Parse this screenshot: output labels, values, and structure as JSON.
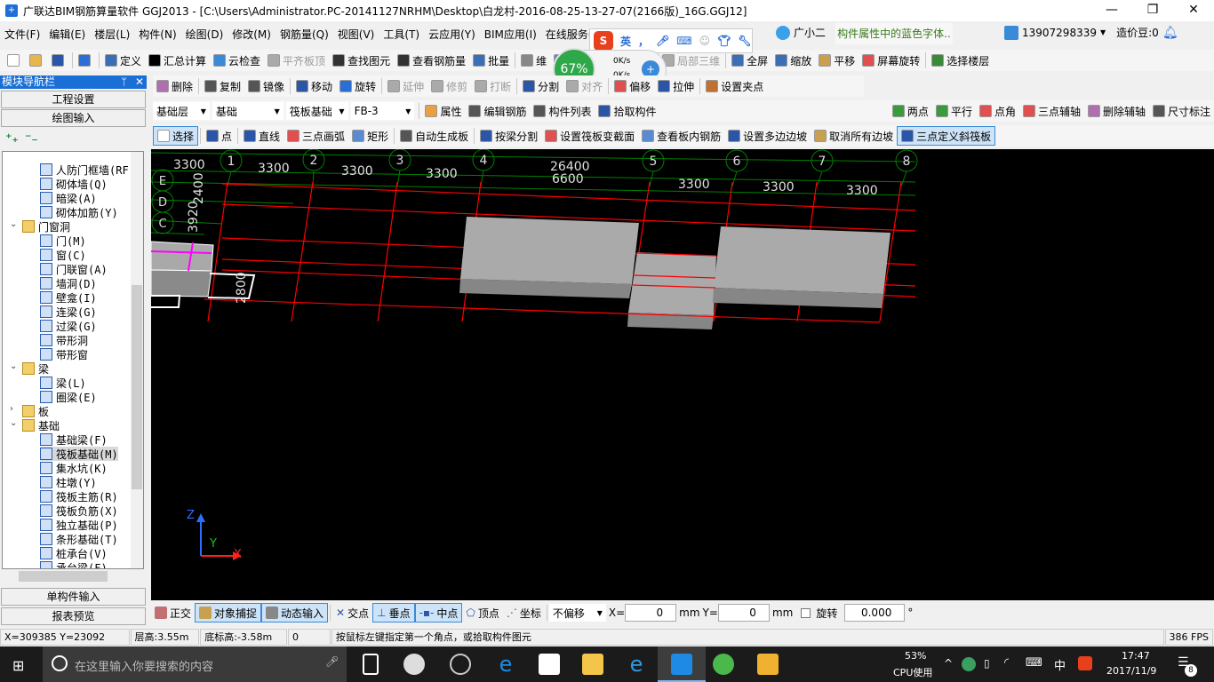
{
  "window": {
    "title": "广联达BIM钢筋算量软件 GGJ2013 - [C:\\Users\\Administrator.PC-20141127NRHM\\Desktop\\白龙村-2016-08-25-13-27-07(2166版)_16G.GGJ12]",
    "minimize": "—",
    "maximize": "❐",
    "close": "✕"
  },
  "menu": [
    "文件(F)",
    "编辑(E)",
    "楼层(L)",
    "构件(N)",
    "绘图(D)",
    "修改(M)",
    "钢筋量(Q)",
    "视图(V)",
    "工具(T)",
    "云应用(Y)",
    "BIM应用(I)",
    "在线服务(S)"
  ],
  "menu_right": {
    "assistant": "广小二",
    "tip": "构件属性中的蓝色字体..",
    "account": "13907298339",
    "beans": "造价豆:0"
  },
  "ime_bar": {
    "lang": "英",
    "punct": "，"
  },
  "net_widget": {
    "percent": "67%",
    "up": "0K/s",
    "down": "0K/s"
  },
  "toolbar1": [
    {
      "label": "",
      "icon": "new-file",
      "color": "#fff"
    },
    {
      "label": "",
      "icon": "open-folder",
      "color": "#e8b64a"
    },
    {
      "label": "",
      "icon": "save",
      "color": "#2b55a8"
    },
    {
      "label": "",
      "icon": "undo",
      "color": "#2b6fd6"
    },
    {
      "label": "定义",
      "icon": "define",
      "color": "#3a6fb8"
    },
    {
      "label": "汇总计算",
      "icon": "sigma",
      "color": "#000"
    },
    {
      "label": "云检查",
      "icon": "cloud-check",
      "color": "#3a8ad8"
    },
    {
      "label": "平齐板顶",
      "icon": "align-top",
      "color": "#aaa",
      "dis": true
    },
    {
      "label": "查找图元",
      "icon": "binoculars",
      "color": "#333"
    },
    {
      "label": "查看钢筋量",
      "icon": "rebar-view",
      "color": "#333"
    },
    {
      "label": "批量",
      "icon": "batch",
      "color": "#3a6fb8"
    },
    {
      "label": "维",
      "icon": "3d",
      "color": "#888"
    },
    {
      "label": "俯视",
      "icon": "top-view",
      "color": "#5a8ad0"
    },
    {
      "label": "动态观察",
      "icon": "orbit",
      "color": "#3b9a3b"
    },
    {
      "label": "局部三维",
      "icon": "local-3d",
      "color": "#aaa",
      "dis": true
    },
    {
      "label": "全屏",
      "icon": "fullscreen",
      "color": "#3a6fb8"
    },
    {
      "label": "缩放",
      "icon": "zoom",
      "color": "#3a6fb8"
    },
    {
      "label": "平移",
      "icon": "pan",
      "color": "#c9a050"
    },
    {
      "label": "屏幕旋转",
      "icon": "screen-rotate",
      "color": "#e05050"
    },
    {
      "label": "选择楼层",
      "icon": "select-floor",
      "color": "#3a8a3a"
    }
  ],
  "toolbar2": [
    {
      "label": "删除",
      "icon": "delete",
      "color": "#b070b0"
    },
    {
      "label": "复制",
      "icon": "copy",
      "color": "#555"
    },
    {
      "label": "镜像",
      "icon": "mirror",
      "color": "#555"
    },
    {
      "label": "移动",
      "icon": "move",
      "color": "#2b55a8"
    },
    {
      "label": "旋转",
      "icon": "rotate",
      "color": "#2b6fd6"
    },
    {
      "label": "延伸",
      "icon": "extend",
      "color": "#aaa",
      "dis": true
    },
    {
      "label": "修剪",
      "icon": "trim",
      "color": "#aaa",
      "dis": true
    },
    {
      "label": "打断",
      "icon": "break",
      "color": "#aaa",
      "dis": true
    },
    {
      "label": "分割",
      "icon": "split",
      "color": "#2b55a8"
    },
    {
      "label": "对齐",
      "icon": "align",
      "color": "#aaa",
      "dis": true
    },
    {
      "label": "偏移",
      "icon": "offset",
      "color": "#e05050"
    },
    {
      "label": "拉伸",
      "icon": "stretch",
      "color": "#2b55a8"
    },
    {
      "label": "设置夹点",
      "icon": "grip",
      "color": "#c07030"
    }
  ],
  "toolbar3": {
    "floor": "基础层",
    "category": "基础",
    "type": "筏板基础",
    "name": "FB-3",
    "items": [
      {
        "label": "属性",
        "icon": "properties",
        "color": "#e8a040"
      },
      {
        "label": "编辑钢筋",
        "icon": "edit-rebar",
        "color": "#555"
      },
      {
        "label": "构件列表",
        "icon": "list",
        "color": "#555"
      },
      {
        "label": "拾取构件",
        "icon": "pick",
        "color": "#2b55a8"
      }
    ],
    "axis_items": [
      {
        "label": "两点",
        "icon": "two-point",
        "color": "#3b9a3b"
      },
      {
        "label": "平行",
        "icon": "parallel",
        "color": "#3b9a3b"
      },
      {
        "label": "点角",
        "icon": "point-angle",
        "color": "#e05050"
      },
      {
        "label": "三点辅轴",
        "icon": "three-point-axis",
        "color": "#e05050"
      },
      {
        "label": "删除辅轴",
        "icon": "delete-axis",
        "color": "#b070b0"
      },
      {
        "label": "尺寸标注",
        "icon": "dimension",
        "color": "#555"
      }
    ]
  },
  "toolbar4": [
    {
      "label": "选择",
      "icon": "cursor",
      "color": "#fff"
    },
    {
      "label": "点",
      "icon": "point",
      "color": "#2b55a8"
    },
    {
      "label": "直线",
      "icon": "line",
      "color": "#2b55a8"
    },
    {
      "label": "三点画弧",
      "icon": "arc",
      "color": "#e05050"
    },
    {
      "label": "矩形",
      "icon": "rectangle",
      "color": "#5a8ad0"
    },
    {
      "label": "自动生成板",
      "icon": "auto-slab",
      "color": "#555"
    },
    {
      "label": "按梁分割",
      "icon": "split-by-beam",
      "color": "#2b55a8"
    },
    {
      "label": "设置筏板变截面",
      "icon": "variable-section",
      "color": "#e05050"
    },
    {
      "label": "查看板内钢筋",
      "icon": "view-slab-rebar",
      "color": "#5a8ad0"
    },
    {
      "label": "设置多边边坡",
      "icon": "multi-slope",
      "color": "#2b55a8"
    },
    {
      "label": "取消所有边坡",
      "icon": "cancel-slope",
      "color": "#c9a050"
    },
    {
      "label": "三点定义斜筏板",
      "icon": "sloped-raft",
      "color": "#2b55a8",
      "active": true
    }
  ],
  "nav": {
    "title": "模块导航栏",
    "pin": "ᛘ",
    "close": "✕",
    "project_settings": "工程设置",
    "drawing_input": "绘图输入",
    "single_input": "单构件输入",
    "report_preview": "报表预览"
  },
  "tree": [
    {
      "label": "人防门框墙(RF",
      "level": 2
    },
    {
      "label": "砌体墙(Q)",
      "level": 2
    },
    {
      "label": "暗梁(A)",
      "level": 2
    },
    {
      "label": "砌体加筋(Y)",
      "level": 2
    },
    {
      "label": "门窗洞",
      "level": 1,
      "folder": true,
      "open": true
    },
    {
      "label": "门(M)",
      "level": 2
    },
    {
      "label": "窗(C)",
      "level": 2
    },
    {
      "label": "门联窗(A)",
      "level": 2
    },
    {
      "label": "墙洞(D)",
      "level": 2
    },
    {
      "label": "壁龛(I)",
      "level": 2
    },
    {
      "label": "连梁(G)",
      "level": 2
    },
    {
      "label": "过梁(G)",
      "level": 2
    },
    {
      "label": "带形洞",
      "level": 2
    },
    {
      "label": "带形窗",
      "level": 2
    },
    {
      "label": "梁",
      "level": 1,
      "folder": true,
      "open": true
    },
    {
      "label": "梁(L)",
      "level": 2
    },
    {
      "label": "圈梁(E)",
      "level": 2
    },
    {
      "label": "板",
      "level": 1,
      "folder": true,
      "open": false
    },
    {
      "label": "基础",
      "level": 1,
      "folder": true,
      "open": true
    },
    {
      "label": "基础梁(F)",
      "level": 2
    },
    {
      "label": "筏板基础(M)",
      "level": 2,
      "selected": true
    },
    {
      "label": "集水坑(K)",
      "level": 2
    },
    {
      "label": "柱墩(Y)",
      "level": 2
    },
    {
      "label": "筏板主筋(R)",
      "level": 2
    },
    {
      "label": "筏板负筋(X)",
      "level": 2
    },
    {
      "label": "独立基础(P)",
      "level": 2
    },
    {
      "label": "条形基础(T)",
      "level": 2
    },
    {
      "label": "桩承台(V)",
      "level": 2
    },
    {
      "label": "承台梁(F)",
      "level": 2
    }
  ],
  "canvas": {
    "axes_num": [
      "1",
      "2",
      "3",
      "4",
      "5",
      "6",
      "7",
      "8"
    ],
    "axes_letter": [
      "E",
      "D",
      "C"
    ],
    "dims_top": [
      "3300",
      "3300",
      "3300",
      "3300",
      "26400",
      "6600",
      "3300",
      "3300",
      "3300"
    ],
    "dims_side": [
      "2400",
      "3920",
      "2800"
    ],
    "coord": {
      "z": "Z",
      "y": "Y",
      "x": "X"
    },
    "colors": {
      "grid": "#ff0000",
      "axis": "#008000",
      "slab": "#a9a9a9",
      "slab_side": "#858585"
    }
  },
  "bottombar": {
    "ortho": "正交",
    "snap": "对象捕捉",
    "dynamic": "动态输入",
    "intersection": "交点",
    "perpendicular": "垂点",
    "midpoint": "中点",
    "vertex": "顶点",
    "coordinate": "坐标",
    "offset_mode": "不偏移",
    "x_label": "X=",
    "x_value": "0",
    "mm1": "mm",
    "y_label": "Y=",
    "y_value": "0",
    "mm2": "mm",
    "rotate_label": "旋转",
    "rotate_value": "0.000",
    "degree": "°"
  },
  "status": {
    "coords": "X=309385 Y=23092",
    "floor_height": "层高:3.55m",
    "bottom_elev": "底标高:-3.58m",
    "value": "0",
    "hint": "按鼠标左键指定第一个角点，或拾取构件图元",
    "fps": "386 FPS"
  },
  "taskbar": {
    "search_placeholder": "在这里输入你要搜索的内容",
    "cpu": "53%",
    "cpu_label": "CPU使用",
    "ime": "中",
    "time": "17:47",
    "date": "2017/11/9",
    "notifications": "8"
  }
}
